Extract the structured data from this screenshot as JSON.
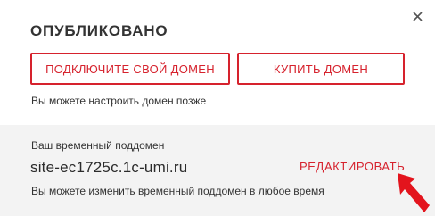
{
  "dialog": {
    "title": "ОПУБЛИКОВАНО",
    "close_icon": "close-icon",
    "buttons": {
      "connect_domain": "ПОДКЛЮЧИТЕ СВОЙ ДОМЕН",
      "buy_domain": "КУПИТЬ ДОМЕН"
    },
    "hint": "Вы можете настроить домен позже"
  },
  "subdomain": {
    "label": "Ваш временный поддомен",
    "value": "site-ec1725c.1c-umi.ru",
    "edit_label": "РЕДАКТИРОВАТЬ",
    "hint": "Вы можете изменить временный поддомен в любое время"
  },
  "colors": {
    "accent": "#d6222d",
    "panel_bg": "#f3f3f3",
    "text": "#333333"
  },
  "annotation": {
    "icon": "arrow-pointer-icon"
  }
}
